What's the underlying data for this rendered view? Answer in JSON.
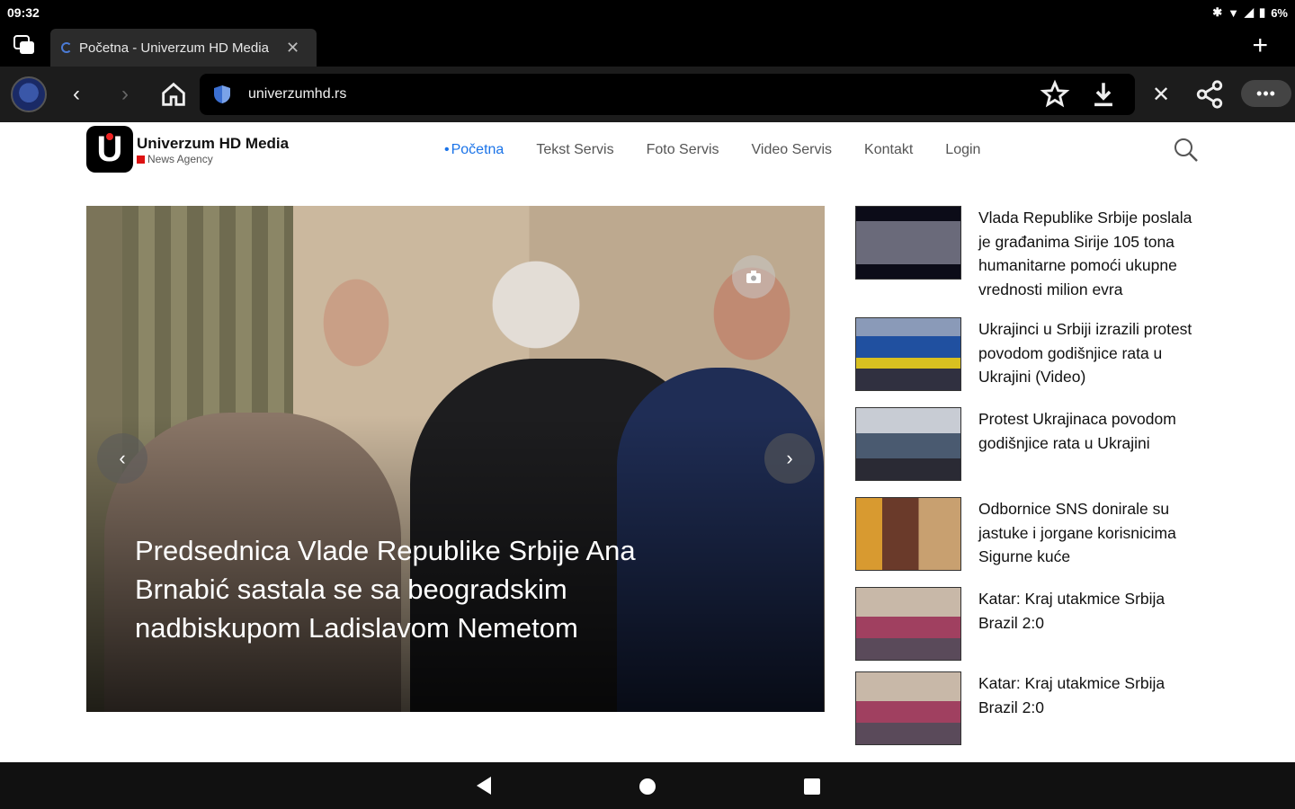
{
  "status": {
    "time": "09:32",
    "battery": "6%"
  },
  "tab": {
    "title": "Početna - Univerzum HD Media"
  },
  "toolbar": {
    "url": "univerzumhd.rs"
  },
  "site": {
    "name": "Univerzum HD Media",
    "tagline": "News Agency",
    "logo_letter": "U"
  },
  "nav": [
    {
      "label": "Početna"
    },
    {
      "label": "Tekst Servis"
    },
    {
      "label": "Foto Servis"
    },
    {
      "label": "Video Servis"
    },
    {
      "label": "Kontakt"
    },
    {
      "label": "Login"
    }
  ],
  "hero": {
    "caption": "Predsednica Vlade Republike Srbije Ana Brnabić sastala se sa beogradskim nadbiskupom Ladislavom Nemetom",
    "prev": "‹",
    "next": "›"
  },
  "sidebar": [
    {
      "title": "Vlada Republike Srbije poslala je građanima Sirije 105 tona humanitarne pomoći ukupne vrednosti milion evra",
      "thumb_color": "#1a1a2a"
    },
    {
      "title": "Ukrajinci u Srbiji izrazili protest povodom godišnjice rata u Ukrajini (Video)",
      "thumb_color": "#2b4a8a"
    },
    {
      "title": "Protest Ukrajinaca povodom godišnjice rata u Ukrajini",
      "thumb_color": "#5a6a7a"
    },
    {
      "title": "Odbornice SNS donirale su jastuke i jorgane korisnicima Sigurne kuće",
      "thumb_color": "#8a3a1a"
    },
    {
      "title": "Katar: Kraj utakmice Srbija Brazil 2:0",
      "thumb_color": "#6a5a6a"
    },
    {
      "title": "Katar: Kraj utakmice Srbija Brazil 2:0",
      "thumb_color": "#6a5a6a"
    }
  ],
  "colors": {
    "accent": "#1a73e8",
    "brand_red": "#d11111"
  }
}
